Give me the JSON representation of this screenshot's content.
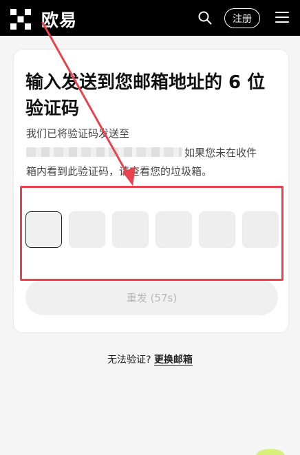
{
  "header": {
    "logo_text": "欧易",
    "register_label": "注册"
  },
  "verify": {
    "title": "输入发送到您邮箱地址的 6 位验证码",
    "desc_line1": "我们已将验证码发送至",
    "desc_line2_suffix": "如果您未在收件",
    "desc_line3": "箱内看到此验证码，请查看您的垃圾箱。",
    "code_length": 6,
    "resend_label": "重发 (57s)"
  },
  "footer": {
    "prompt": "无法验证?",
    "change_email_label": "更换邮箱"
  },
  "colors": {
    "annotation": "#e8424f",
    "header_bg": "#000000"
  }
}
